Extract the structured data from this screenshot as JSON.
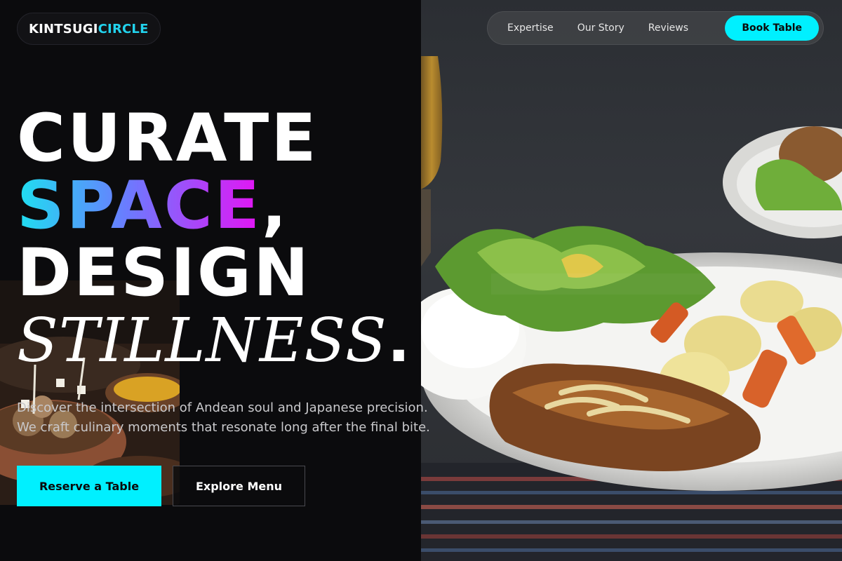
{
  "brand": {
    "part1": "KINTSUGI",
    "part2": "CIRCLE"
  },
  "nav": {
    "links": [
      "Expertise",
      "Our Story",
      "Reviews"
    ],
    "cta": "Book Table"
  },
  "hero": {
    "line1": "CURATE",
    "line2_gradient": "SPACE",
    "line2_comma": ",",
    "line3": "DESIGN",
    "line4": "STILLNESS",
    "line4_dot": ".",
    "subtitle_line1": "Discover the intersection of Andean soul and Japanese precision.",
    "subtitle_line2": "We craft culinary moments that resonate long after the final bite.",
    "primary_button": "Reserve a Table",
    "secondary_button": "Explore Menu"
  },
  "colors": {
    "accent": "#00f0ff",
    "gradient_start": "#1ee0f0",
    "gradient_end": "#e513f3",
    "background": "#0b0b0d"
  },
  "images": {
    "hero_photo": "grilled-chicken-plate-with-rice-salad-potatoes-photo",
    "inset_photo": "clay-bowls-with-potatoes-and-sauce-photo"
  }
}
